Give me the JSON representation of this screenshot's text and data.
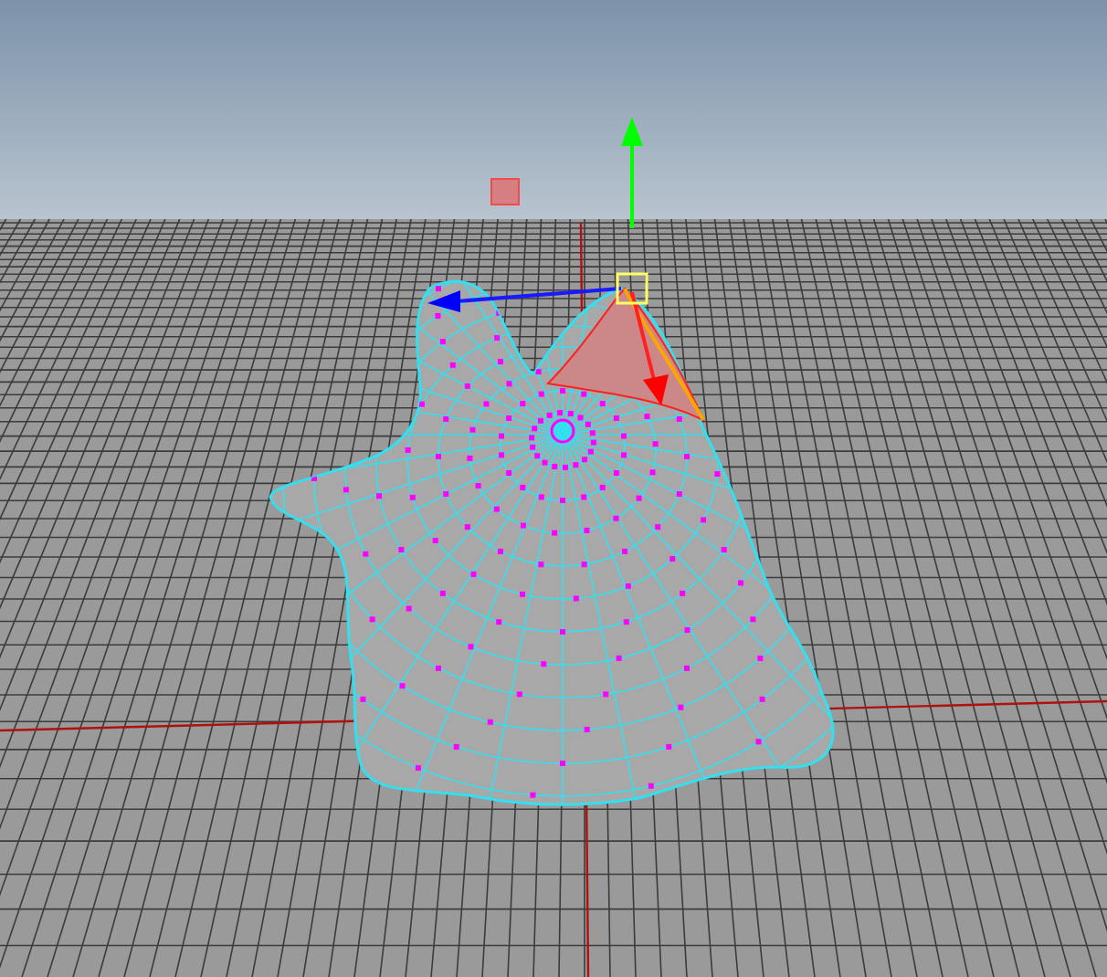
{
  "viewport": {
    "grid": true,
    "manipulator": true
  }
}
